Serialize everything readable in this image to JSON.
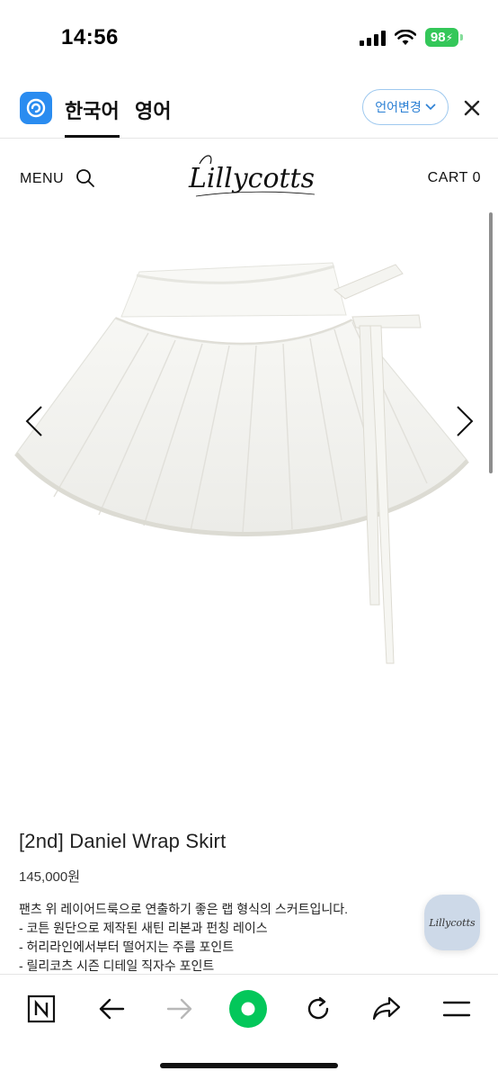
{
  "status_bar": {
    "time": "14:56",
    "battery": "98"
  },
  "translate_bar": {
    "active_language": "한국어",
    "other_language": "영어",
    "change_button": "언어변경"
  },
  "site_header": {
    "menu_label": "MENU",
    "brand": "Lillycotts",
    "cart_label": "CART 0"
  },
  "product": {
    "title": "[2nd] Daniel Wrap Skirt",
    "price": "145,000원",
    "description": [
      "팬츠 위 레이어드룩으로 연출하기 좋은 랩 형식의 스커트입니다.",
      "- 코튼 원단으로 제작된 새틴 리본과 펀칭 레이스",
      "- 허리라인에서부터 떨어지는 주름 포인트",
      "- 릴리코츠 시즌 디테일 직자수 포인트"
    ]
  },
  "chat_button": {
    "brand": "Lillycotts"
  },
  "toolbar": {
    "items": [
      "naver-icon",
      "back-icon",
      "forward-icon",
      "home-green-icon",
      "reload-icon",
      "share-icon",
      "menu-icon"
    ]
  },
  "colors": {
    "accent_blue": "#2a8cf0",
    "battery_green": "#34c759",
    "nav_green": "#03c75a",
    "chat_bubble": "#cdd9e8"
  }
}
